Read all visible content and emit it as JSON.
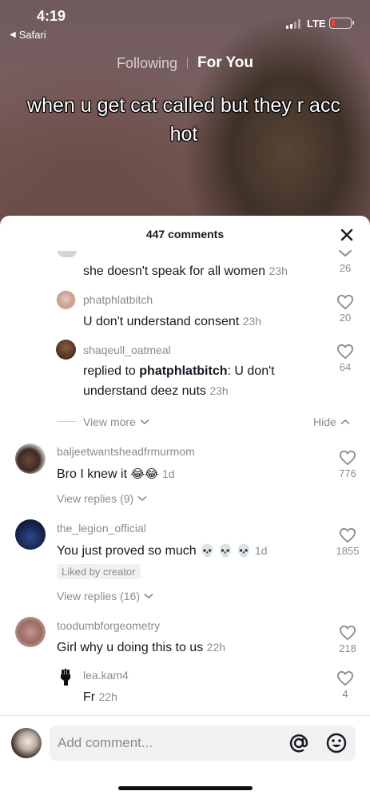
{
  "status_bar": {
    "time": "4:19",
    "back_app": "Safari",
    "network": "LTE"
  },
  "feed_tabs": {
    "following": "Following",
    "for_you": "For You"
  },
  "video": {
    "caption": "when u get cat called but they r acc hot"
  },
  "comments_header": {
    "title": "447 comments"
  },
  "comments": [
    {
      "user": "",
      "text": "she doesn't speak for all women",
      "time": "23h",
      "likes": "26"
    },
    {
      "user": "phatphlatbitch",
      "text": "U don't understand consent",
      "time": "23h",
      "likes": "20"
    },
    {
      "user": "shaqeull_oatmeal",
      "reply_prefix": "replied to",
      "reply_to": "phatphlatbitch",
      "text": ": U don't understand deez nuts",
      "time": "23h",
      "likes": "64"
    },
    {
      "user": "baljeetwantsheadfrmurmom",
      "text": "Bro I knew it",
      "emojis": "😂😂",
      "time": "1d",
      "likes": "776",
      "view_replies": "View replies (9)"
    },
    {
      "user": "the_legion_official",
      "text": "You just proved so much",
      "emojis": "💀 💀 💀",
      "time": "1d",
      "likes": "1855",
      "badge": "Liked by creator",
      "view_replies": "View replies (16)"
    },
    {
      "user": "toodumbforgeometry",
      "text": "Girl why u doing this to us",
      "time": "22h",
      "likes": "218"
    },
    {
      "user": "lea.kam4",
      "text": "Fr",
      "time": "22h",
      "likes": "4"
    }
  ],
  "thread_controls": {
    "view_more": "View more",
    "hide": "Hide"
  },
  "input": {
    "placeholder": "Add comment..."
  },
  "icons": {
    "mention": "at-icon",
    "emoji": "smiley-icon",
    "close": "close-icon",
    "like": "heart-outline-icon",
    "fist": "raised-fist-icon"
  },
  "colors": {
    "text_primary": "#161823",
    "text_secondary": "#8a8b91",
    "badge_bg": "#f1f1f2",
    "battery_low": "#ff3b30"
  }
}
